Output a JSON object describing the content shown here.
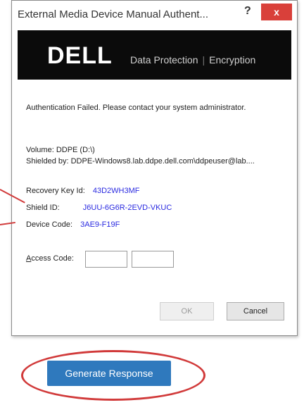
{
  "window": {
    "title": "External Media Device Manual Authent...",
    "help_label": "?",
    "close_label": "x"
  },
  "banner": {
    "logo": "DELL",
    "product_left": "Data Protection",
    "product_sep": "|",
    "product_right": "Encryption"
  },
  "message": "Authentication Failed. Please contact your system administrator.",
  "volume": {
    "label": "Volume:",
    "value": "DDPE (D:\\)"
  },
  "shielded_by": {
    "label": "Shielded by:",
    "value": "DDPE-Windows8.lab.ddpe.dell.com\\ddpeuser@lab...."
  },
  "recovery_key_id": {
    "label": "Recovery Key Id:",
    "value": "43D2WH3MF"
  },
  "shield_id": {
    "label": "Shield ID:",
    "value": "J6UU-6G6R-2EVD-VKUC"
  },
  "device_code": {
    "label": "Device Code:",
    "value": "3AE9-F19F"
  },
  "access_code": {
    "label_first": "A",
    "label_rest": "ccess Code:",
    "value_1": "",
    "value_2": ""
  },
  "buttons": {
    "ok": "OK",
    "cancel": "Cancel",
    "generate": "Generate Response"
  },
  "colors": {
    "accent_blue": "#2f79bd",
    "annotation_red": "#d13a3a",
    "close_red": "#d9403a",
    "value_blue": "#2a2ae0"
  }
}
